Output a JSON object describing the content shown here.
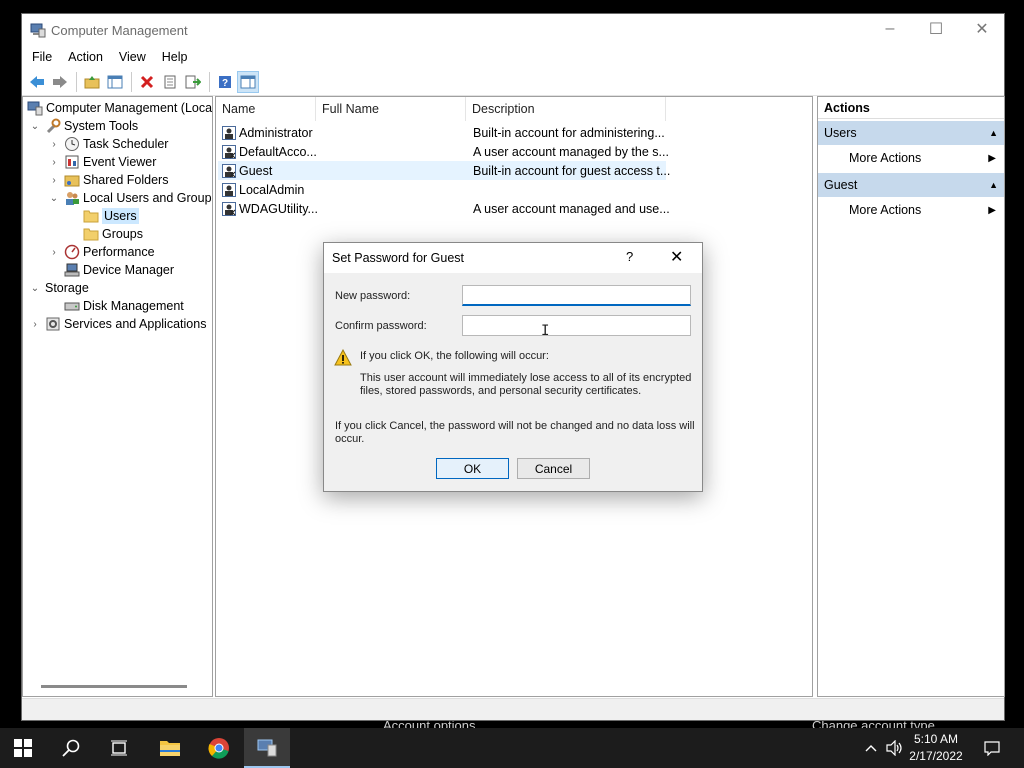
{
  "window": {
    "title": "Computer Management",
    "controls": {
      "minimize": "–",
      "maximize": "☐",
      "close": "✕"
    }
  },
  "menu": [
    "File",
    "Action",
    "View",
    "Help"
  ],
  "tree": {
    "root": "Computer Management (Local",
    "system_tools": "System Tools",
    "task_scheduler": "Task Scheduler",
    "event_viewer": "Event Viewer",
    "shared_folders": "Shared Folders",
    "local_users_groups": "Local Users and Groups",
    "users": "Users",
    "groups": "Groups",
    "performance": "Performance",
    "device_manager": "Device Manager",
    "storage": "Storage",
    "disk_management": "Disk Management",
    "services_apps": "Services and Applications"
  },
  "list": {
    "columns": {
      "name": "Name",
      "full_name": "Full Name",
      "description": "Description"
    },
    "rows": [
      {
        "name": "Administrator",
        "full_name": "",
        "description": "Built-in account for administering..."
      },
      {
        "name": "DefaultAcco...",
        "full_name": "",
        "description": "A user account managed by the s..."
      },
      {
        "name": "Guest",
        "full_name": "",
        "description": "Built-in account for guest access t..."
      },
      {
        "name": "LocalAdmin",
        "full_name": "",
        "description": ""
      },
      {
        "name": "WDAGUtility...",
        "full_name": "",
        "description": "A user account managed and use..."
      }
    ]
  },
  "actions": {
    "title": "Actions",
    "section1": "Users",
    "section1_item": "More Actions",
    "section2": "Guest",
    "section2_item": "More Actions"
  },
  "background": {
    "left_text": "Account options",
    "right_text": "Change account type"
  },
  "dialog": {
    "title": "Set Password for Guest",
    "help": "?",
    "close": "✕",
    "new_password_label": "New password:",
    "new_password_value": "",
    "confirm_password_label": "Confirm password:",
    "confirm_password_value": "",
    "warning_heading": "If you click OK, the following will occur:",
    "warning_line1": "This user account will immediately lose access to all of its encrypted",
    "warning_line2": "files, stored passwords, and personal security certificates.",
    "cancel_line1": "If you click Cancel, the password will not be changed and no data loss will",
    "cancel_line2": "occur.",
    "ok": "OK",
    "cancel": "Cancel"
  },
  "taskbar": {
    "time": "5:10 AM",
    "date": "2/17/2022"
  },
  "colors": {
    "selection": "#cce8ff",
    "actions_section": "#c6d9ec",
    "accent": "#0067c0",
    "taskbar": "#1c1c1c"
  }
}
